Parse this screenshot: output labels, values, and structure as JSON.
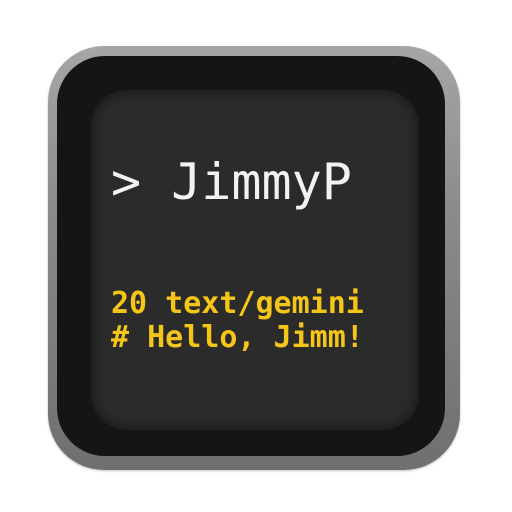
{
  "icon": {
    "prompt": "> JimmyP",
    "status_line": "20 text/gemini",
    "heading_line": "# Hello, Jimm!"
  },
  "colors": {
    "screen_background": "#2b2b2b",
    "prompt_text": "#f2f2f2",
    "response_text": "#f5c518",
    "bezel": "#151515",
    "frame": "#8a8a8a"
  }
}
